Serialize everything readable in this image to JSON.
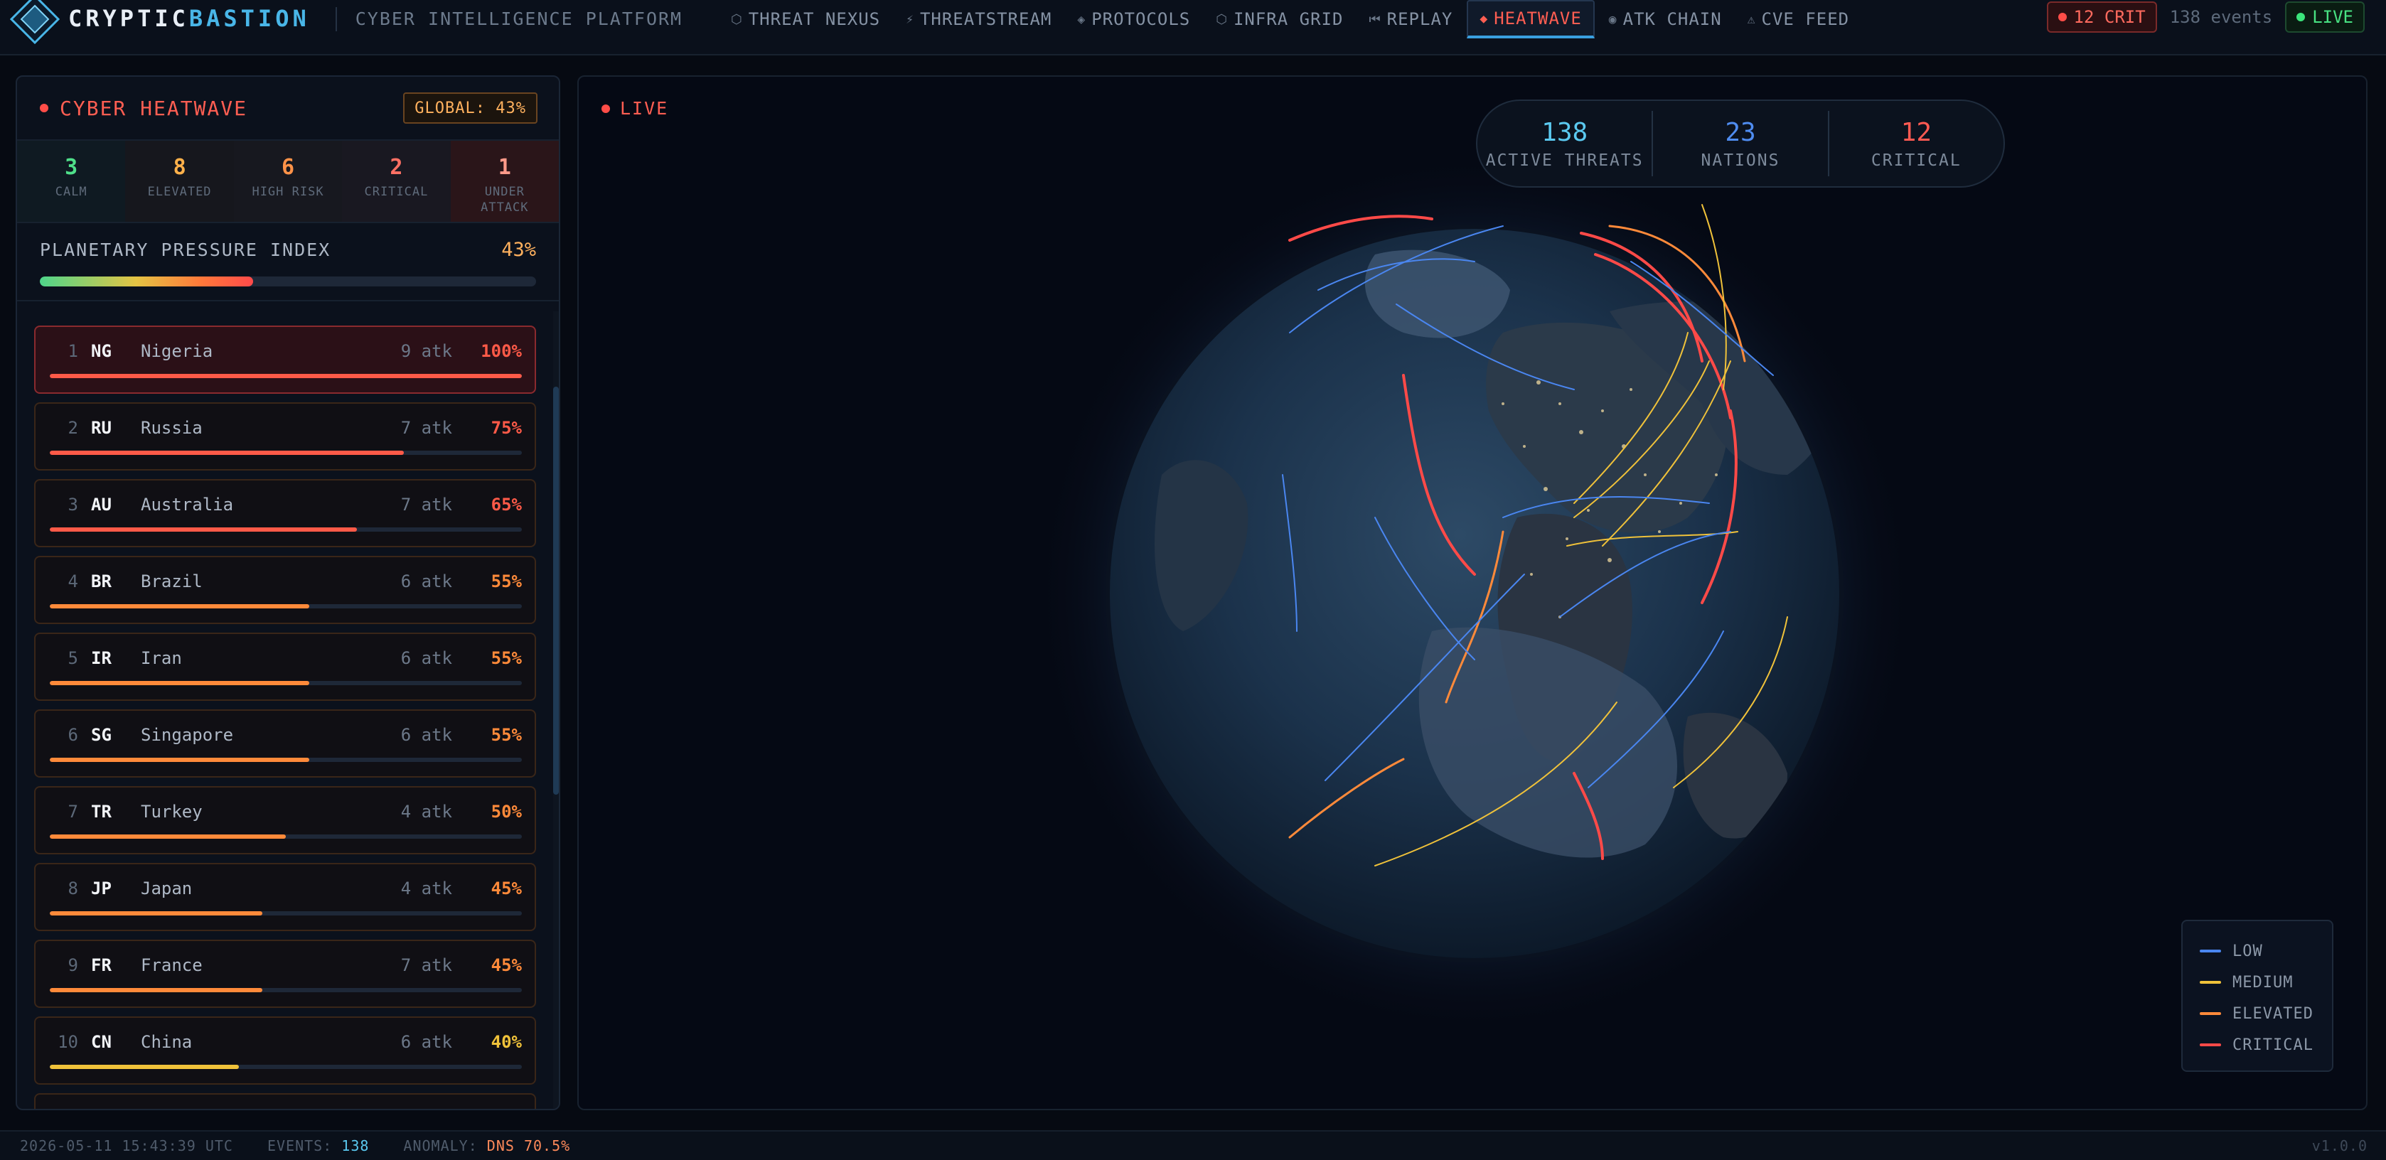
{
  "brand": {
    "name_a": "CRYPTIC",
    "name_b": "BASTION",
    "platform": "CYBER INTELLIGENCE PLATFORM"
  },
  "nav": [
    {
      "glyph": "⬡",
      "label": "THREAT NEXUS",
      "icon": "hexagon-icon",
      "active": false
    },
    {
      "glyph": "⚡",
      "label": "THREATSTREAM",
      "icon": "bolt-icon",
      "active": false
    },
    {
      "glyph": "◈",
      "label": "PROTOCOLS",
      "icon": "diamond-icon",
      "active": false
    },
    {
      "glyph": "⬡",
      "label": "INFRA GRID",
      "icon": "hexagon-icon",
      "active": false
    },
    {
      "glyph": "⏮",
      "label": "REPLAY",
      "icon": "replay-icon",
      "active": false
    },
    {
      "glyph": "◆",
      "label": "HEATWAVE",
      "icon": "diamond-icon",
      "active": true
    },
    {
      "glyph": "◉",
      "label": "ATK CHAIN",
      "icon": "target-icon",
      "active": false
    },
    {
      "glyph": "⚠",
      "label": "CVE FEED",
      "icon": "warning-icon",
      "active": false
    }
  ],
  "top_right": {
    "crit_label": "12 CRIT",
    "events_label": "138 events",
    "live_label": "LIVE"
  },
  "panel": {
    "title": "CYBER HEATWAVE",
    "global_label": "GLOBAL: 43%",
    "stats": [
      {
        "num": "3",
        "label": "CALM"
      },
      {
        "num": "8",
        "label": "ELEVATED"
      },
      {
        "num": "6",
        "label": "HIGH RISK"
      },
      {
        "num": "2",
        "label": "CRITICAL"
      },
      {
        "num": "1",
        "label": "UNDER ATTACK"
      }
    ],
    "pressure_label": "PLANETARY PRESSURE INDEX",
    "pressure_value": "43%",
    "pressure_fraction": 0.43
  },
  "countries": [
    {
      "rank": "1",
      "code": "NG",
      "name": "Nigeria",
      "atk": "9 atk",
      "pct": "100%",
      "fraction": 1.0,
      "color": "#ff5a48"
    },
    {
      "rank": "2",
      "code": "RU",
      "name": "Russia",
      "atk": "7 atk",
      "pct": "75%",
      "fraction": 0.75,
      "color": "#ff5a48"
    },
    {
      "rank": "3",
      "code": "AU",
      "name": "Australia",
      "atk": "7 atk",
      "pct": "65%",
      "fraction": 0.65,
      "color": "#ff5a48"
    },
    {
      "rank": "4",
      "code": "BR",
      "name": "Brazil",
      "atk": "6 atk",
      "pct": "55%",
      "fraction": 0.55,
      "color": "#ff8a3a"
    },
    {
      "rank": "5",
      "code": "IR",
      "name": "Iran",
      "atk": "6 atk",
      "pct": "55%",
      "fraction": 0.55,
      "color": "#ff8a3a"
    },
    {
      "rank": "6",
      "code": "SG",
      "name": "Singapore",
      "atk": "6 atk",
      "pct": "55%",
      "fraction": 0.55,
      "color": "#ff8a3a"
    },
    {
      "rank": "7",
      "code": "TR",
      "name": "Turkey",
      "atk": "4 atk",
      "pct": "50%",
      "fraction": 0.5,
      "color": "#ff8a3a"
    },
    {
      "rank": "8",
      "code": "JP",
      "name": "Japan",
      "atk": "4 atk",
      "pct": "45%",
      "fraction": 0.45,
      "color": "#ff8a3a"
    },
    {
      "rank": "9",
      "code": "FR",
      "name": "France",
      "atk": "7 atk",
      "pct": "45%",
      "fraction": 0.45,
      "color": "#ff8a3a"
    },
    {
      "rank": "10",
      "code": "CN",
      "name": "China",
      "atk": "6 atk",
      "pct": "40%",
      "fraction": 0.4,
      "color": "#f0c23a"
    }
  ],
  "view": {
    "live_label": "LIVE",
    "kpis": [
      {
        "value": "138",
        "label": "ACTIVE THREATS"
      },
      {
        "value": "23",
        "label": "NATIONS"
      },
      {
        "value": "12",
        "label": "CRITICAL"
      }
    ],
    "legend": [
      {
        "label": "LOW",
        "color": "#4a86f0"
      },
      {
        "label": "MEDIUM",
        "color": "#f0c23a"
      },
      {
        "label": "ELEVATED",
        "color": "#ff8a3a"
      },
      {
        "label": "CRITICAL",
        "color": "#ff4a48"
      }
    ]
  },
  "status": {
    "timestamp": "2026-05-11 15:43:39 UTC",
    "events_key": "EVENTS:",
    "events_val": "138",
    "anomaly_key": "ANOMALY:",
    "anomaly_val": "DNS 70.5%",
    "version": "v1.0.0"
  }
}
